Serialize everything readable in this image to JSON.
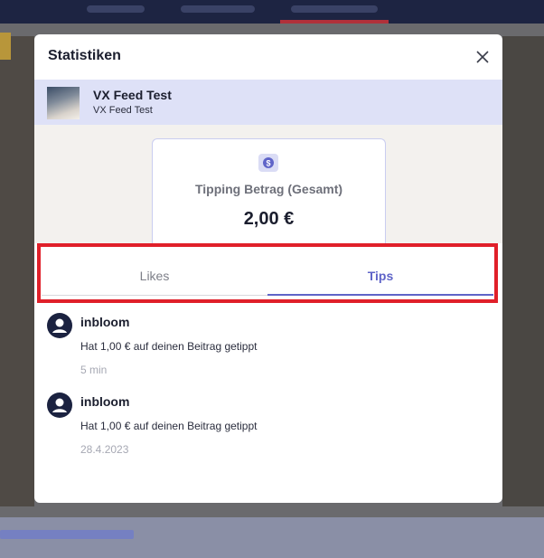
{
  "modal": {
    "title": "Statistiken"
  },
  "post": {
    "title": "VX Feed Test",
    "subtitle": "VX Feed Test"
  },
  "stat": {
    "icon": "dollar-circle-icon",
    "label": "Tipping Betrag (Gesamt)",
    "value": "2,00 €"
  },
  "tabs": [
    {
      "label": "Likes",
      "active": false
    },
    {
      "label": "Tips",
      "active": true
    }
  ],
  "entries": [
    {
      "user": "inbloom",
      "message": "Hat 1,00 € auf deinen Beitrag getippt",
      "time": "5 min"
    },
    {
      "user": "inbloom",
      "message": "Hat 1,00 € auf deinen Beitrag getippt",
      "time": "28.4.2023"
    }
  ],
  "colors": {
    "accent": "#5f64c8",
    "highlight": "#e0202a",
    "post_row_bg": "#dee1f7"
  }
}
